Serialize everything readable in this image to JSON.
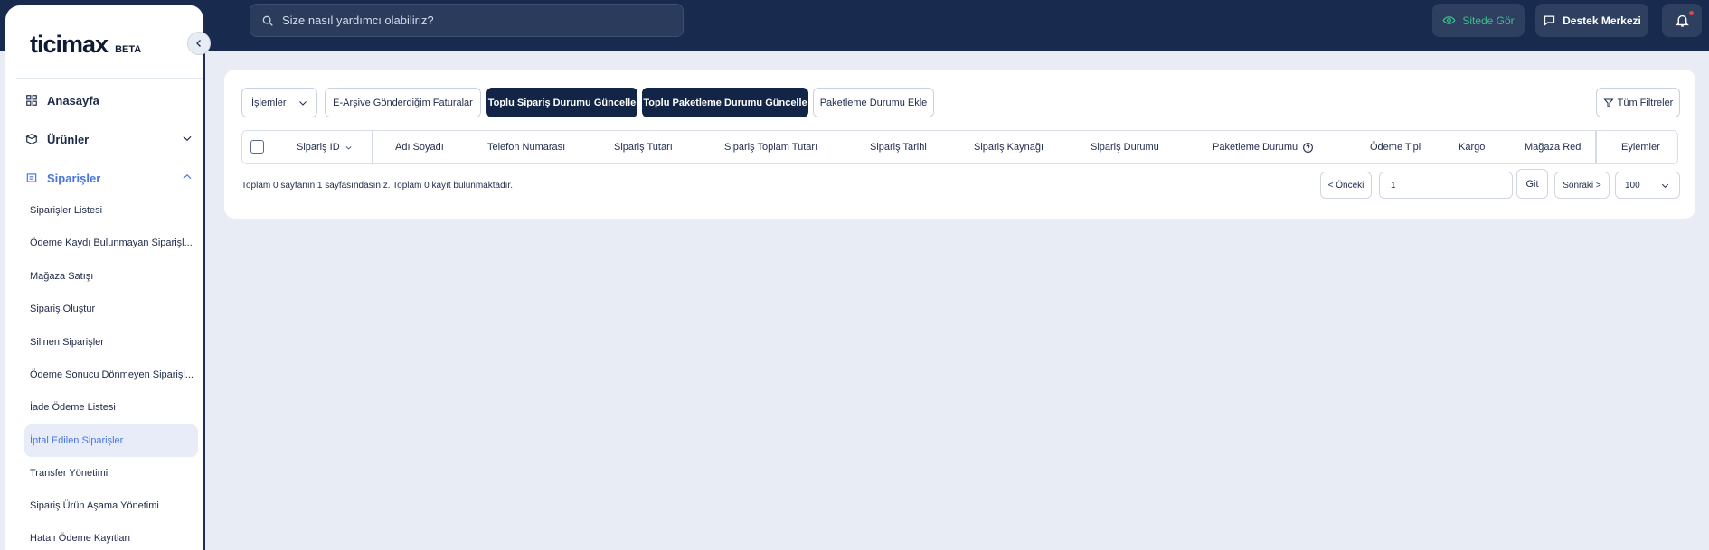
{
  "header": {
    "search_placeholder": "Size nasıl yardımcı olabiliriz?",
    "view_site_label": "Sitede Gör",
    "support_label": "Destek Merkezi",
    "notification_icon": "bell-icon"
  },
  "sidebar": {
    "logo": "ticimax",
    "beta": "BETA",
    "main_items": [
      {
        "label": "Anasayfa",
        "icon": "grid-icon"
      },
      {
        "label": "Ürünler",
        "icon": "box-icon"
      },
      {
        "label": "Siparişler",
        "icon": "orders-icon"
      }
    ],
    "sub_items": [
      "Siparişler Listesi",
      "Ödeme Kaydı Bulunmayan Siparişl...",
      "Mağaza Satışı",
      "Sipariş Oluştur",
      "Silinen Siparişler",
      "Ödeme Sonucu Dönmeyen Siparişl...",
      "İade Ödeme Listesi",
      "İptal Edilen Siparişler",
      "Transfer Yönetimi",
      "Sipariş Ürün Aşama Yönetimi",
      "Hatalı Ödeme Kayıtları"
    ],
    "active_sub_item": "İptal Edilen Siparişler"
  },
  "toolbar": {
    "operations_label": "İşlemler",
    "e_archive_label": "E-Arşive Gönderdiğim Faturalar",
    "bulk_order_status_label": "Toplu Sipariş Durumu Güncelle",
    "bulk_package_status_label": "Toplu Paketleme Durumu Güncelle",
    "add_package_status_label": "Paketleme Durumu Ekle",
    "all_filters_label": "Tüm Filtreler"
  },
  "table": {
    "columns": [
      "Sipariş ID",
      "Adı Soyadı",
      "Telefon Numarası",
      "Sipariş Tutarı",
      "Sipariş Toplam Tutarı",
      "Sipariş Tarihi",
      "Sipariş Kaynağı",
      "Sipariş Durumu",
      "Paketleme Durumu",
      "Ödeme Tipi",
      "Kargo",
      "Mağaza Red",
      "Eylemler"
    ]
  },
  "pagination": {
    "summary": "Toplam 0 sayfanın 1 sayfasındasınız. Toplam 0 kayıt bulunmaktadır.",
    "prev_label": "< Önceki",
    "page_value": "1",
    "go_label": "Git",
    "next_label": "Sonraki >",
    "page_size": "100"
  },
  "colors": {
    "header_bg": "#182a4d",
    "accent": "#4a74e0",
    "success": "#35c38a",
    "dark_button": "#132546"
  }
}
